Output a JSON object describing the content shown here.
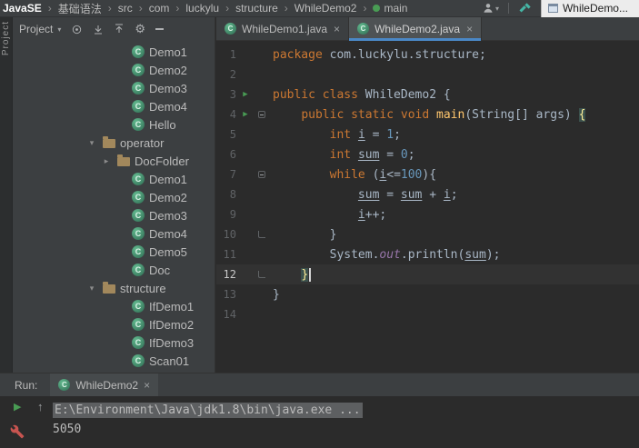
{
  "colors": {
    "accent_blue": "#4a88c7",
    "keyword_orange": "#cc7832",
    "number_blue": "#6897bb",
    "method_yellow": "#ffc66d",
    "field_purple": "#9876aa",
    "run_green": "#499c54",
    "class_icon_green": "#3f9e7c",
    "folder_icon_olive": "#a2885c",
    "wrench_red": "#c75450",
    "hammer_teal": "#45b5a5"
  },
  "topbar": {
    "separator": "›",
    "breadcrumb": [
      {
        "label": "JavaSE",
        "bold": true
      },
      {
        "label": "基础语法"
      },
      {
        "label": "src"
      },
      {
        "label": "com"
      },
      {
        "label": "luckylu"
      },
      {
        "label": "structure"
      },
      {
        "label": "WhileDemo2"
      },
      {
        "label": "main",
        "icon": "run-config"
      }
    ],
    "floating_window_title": "WhileDemo..."
  },
  "tool_strip": {
    "label": "Project"
  },
  "project_panel": {
    "title": "Project",
    "caret": "▾",
    "class_icon_letter": "C",
    "tree": [
      {
        "label": "Demo1",
        "kind": "class",
        "level": 2
      },
      {
        "label": "Demo2",
        "kind": "class",
        "level": 2
      },
      {
        "label": "Demo3",
        "kind": "class",
        "level": 2
      },
      {
        "label": "Demo4",
        "kind": "class",
        "level": 2
      },
      {
        "label": "Hello",
        "kind": "class",
        "level": 2
      },
      {
        "label": "operator",
        "kind": "folder",
        "level": 0,
        "arrow": "down"
      },
      {
        "label": "DocFolder",
        "kind": "folder",
        "level": 1,
        "arrow": "right"
      },
      {
        "label": "Demo1",
        "kind": "class",
        "level": 2
      },
      {
        "label": "Demo2",
        "kind": "class",
        "level": 2
      },
      {
        "label": "Demo3",
        "kind": "class",
        "level": 2
      },
      {
        "label": "Demo4",
        "kind": "class",
        "level": 2
      },
      {
        "label": "Demo5",
        "kind": "class",
        "level": 2
      },
      {
        "label": "Doc",
        "kind": "class",
        "level": 2
      },
      {
        "label": "structure",
        "kind": "folder",
        "level": 0,
        "arrow": "down"
      },
      {
        "label": "IfDemo1",
        "kind": "class",
        "level": 2
      },
      {
        "label": "IfDemo2",
        "kind": "class",
        "level": 2
      },
      {
        "label": "IfDemo3",
        "kind": "class",
        "level": 2
      },
      {
        "label": "Scan01",
        "kind": "class",
        "level": 2
      }
    ]
  },
  "editor": {
    "tabs": [
      {
        "label": "WhileDemo1.java",
        "close": "×",
        "active": false
      },
      {
        "label": "WhileDemo2.java",
        "close": "×",
        "active": true
      }
    ],
    "lines": [
      {
        "n": 1,
        "tokens": [
          [
            "kw",
            "package "
          ],
          [
            "pl",
            "com.luckylu.structure;"
          ]
        ]
      },
      {
        "n": 2,
        "tokens": []
      },
      {
        "n": 3,
        "run": true,
        "tokens": [
          [
            "kw",
            "public class "
          ],
          [
            "pl",
            "WhileDemo2 {"
          ]
        ]
      },
      {
        "n": 4,
        "run": true,
        "fold": "open",
        "tokens": [
          [
            "pl",
            "    "
          ],
          [
            "kw",
            "public static void "
          ],
          [
            "fn",
            "main"
          ],
          [
            "pl",
            "(String[] args) "
          ],
          [
            "bm",
            "{"
          ]
        ]
      },
      {
        "n": 5,
        "tokens": [
          [
            "pl",
            "        "
          ],
          [
            "kw",
            "int "
          ],
          [
            "var",
            "i"
          ],
          [
            "pl",
            " = "
          ],
          [
            "num",
            "1"
          ],
          [
            "pl",
            ";"
          ]
        ]
      },
      {
        "n": 6,
        "tokens": [
          [
            "pl",
            "        "
          ],
          [
            "kw",
            "int "
          ],
          [
            "var",
            "sum"
          ],
          [
            "pl",
            " = "
          ],
          [
            "num",
            "0"
          ],
          [
            "pl",
            ";"
          ]
        ]
      },
      {
        "n": 7,
        "fold": "open",
        "tokens": [
          [
            "pl",
            "        "
          ],
          [
            "kw",
            "while "
          ],
          [
            "pl",
            "("
          ],
          [
            "var",
            "i"
          ],
          [
            "pl",
            "<="
          ],
          [
            "num",
            "100"
          ],
          [
            "pl",
            "){"
          ]
        ]
      },
      {
        "n": 8,
        "tokens": [
          [
            "pl",
            "            "
          ],
          [
            "var",
            "sum"
          ],
          [
            "pl",
            " = "
          ],
          [
            "var",
            "sum"
          ],
          [
            "pl",
            " + "
          ],
          [
            "var",
            "i"
          ],
          [
            "pl",
            ";"
          ]
        ]
      },
      {
        "n": 9,
        "tokens": [
          [
            "pl",
            "            "
          ],
          [
            "var",
            "i"
          ],
          [
            "pl",
            "++;"
          ]
        ]
      },
      {
        "n": 10,
        "fold": "end",
        "tokens": [
          [
            "pl",
            "        }"
          ]
        ]
      },
      {
        "n": 11,
        "tokens": [
          [
            "pl",
            "        System."
          ],
          [
            "field",
            "out"
          ],
          [
            "pl",
            ".println("
          ],
          [
            "var",
            "sum"
          ],
          [
            "pl",
            ");"
          ]
        ]
      },
      {
        "n": 12,
        "fold": "end",
        "active": true,
        "cursor": true,
        "tokens": [
          [
            "pl",
            "    "
          ],
          [
            "bm",
            "}"
          ]
        ]
      },
      {
        "n": 13,
        "tokens": [
          [
            "pl",
            "}"
          ]
        ]
      },
      {
        "n": 14,
        "tokens": []
      }
    ]
  },
  "run_panel": {
    "label": "Run:",
    "tab": {
      "label": "WhileDemo2",
      "close": "×"
    },
    "console": [
      {
        "text": "E:\\Environment\\Java\\jdk1.8\\bin\\java.exe ...",
        "highlight": true
      },
      {
        "text": "5050",
        "highlight": false
      }
    ]
  }
}
